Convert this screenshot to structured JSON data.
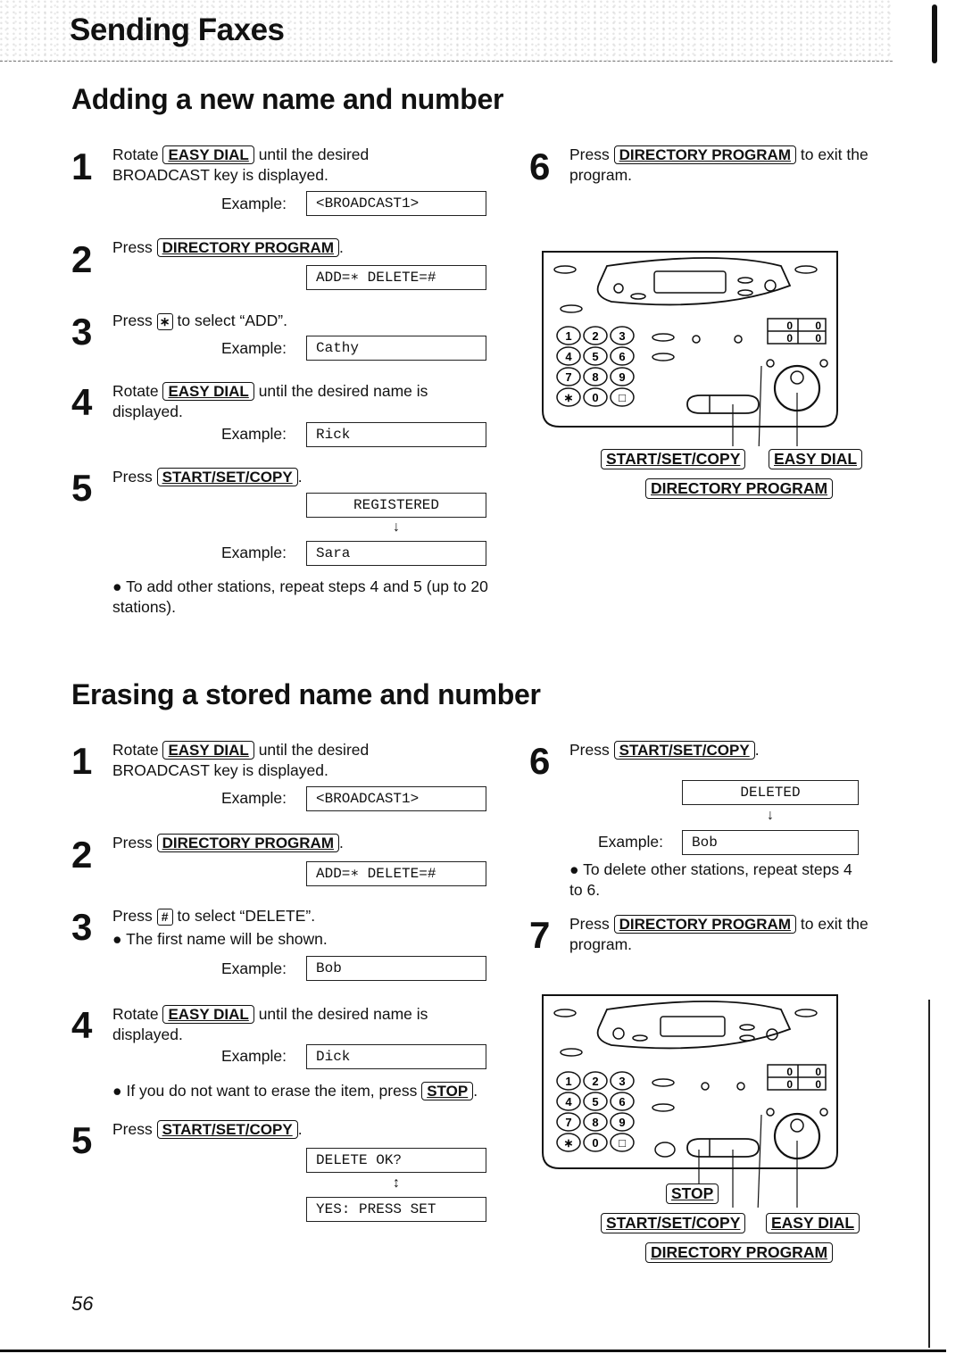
{
  "header": {
    "chapter_title": "Sending Faxes"
  },
  "sections": {
    "adding": {
      "title": "Adding a new name and number",
      "steps": [
        {
          "num": "1",
          "pre": "Rotate",
          "key": "EASY DIAL",
          "post": "until the desired BROADCAST key is displayed.",
          "example_label": "Example:",
          "display": "<BROADCAST1>"
        },
        {
          "num": "2",
          "pre": "Press",
          "key": "DIRECTORY PROGRAM",
          "post": ".",
          "display": "ADD=∗ DELETE=#"
        },
        {
          "num": "3",
          "pre": "Press",
          "key": "∗",
          "post": "to select “ADD”.",
          "example_label": "Example:",
          "display": "Cathy"
        },
        {
          "num": "4",
          "pre": "Rotate",
          "key": "EASY DIAL",
          "post": "until the desired name is displayed.",
          "example_label": "Example:",
          "display": "Rick"
        },
        {
          "num": "5",
          "pre": "Press",
          "key": "START/SET/COPY",
          "post": ".",
          "display_1": "REGISTERED",
          "arrow": "↓",
          "example_label": "Example:",
          "display_2": "Sara",
          "note": "To add other stations, repeat steps 4 and 5 (up to 20 stations)."
        },
        {
          "num": "6",
          "pre": "Press",
          "key": "DIRECTORY PROGRAM",
          "post": "to exit the program."
        }
      ],
      "diagram": {
        "callouts": [
          "START/SET/COPY",
          "EASY DIAL",
          "DIRECTORY PROGRAM"
        ],
        "keypad": [
          "1",
          "2",
          "3",
          "4",
          "5",
          "6",
          "7",
          "8",
          "9",
          "∗",
          "0",
          "□"
        ],
        "counter": [
          "0",
          "0",
          "0",
          "0"
        ]
      }
    },
    "erasing": {
      "title": "Erasing a stored name and number",
      "steps": [
        {
          "num": "1",
          "pre": "Rotate",
          "key": "EASY DIAL",
          "post": "until the desired BROADCAST key is displayed.",
          "example_label": "Example:",
          "display": "<BROADCAST1>"
        },
        {
          "num": "2",
          "pre": "Press",
          "key": "DIRECTORY PROGRAM",
          "post": ".",
          "display": "ADD=∗ DELETE=#"
        },
        {
          "num": "3",
          "pre": "Press",
          "key": "#",
          "post": "to select “DELETE”.",
          "note": "The first name will be shown.",
          "example_label": "Example:",
          "display": "Bob"
        },
        {
          "num": "4",
          "pre": "Rotate",
          "key": "EASY DIAL",
          "post": "until the desired name is displayed.",
          "example_label": "Example:",
          "display": "Dick",
          "note_pre": "If you do not want to erase the item, press",
          "note_key": "STOP",
          "note_post": "."
        },
        {
          "num": "5",
          "pre": "Press",
          "key": "START/SET/COPY",
          "post": ".",
          "display_1": "DELETE OK?",
          "arrow": "↕",
          "display_2": "YES: PRESS SET"
        },
        {
          "num": "6",
          "pre": "Press",
          "key": "START/SET/COPY",
          "post": ".",
          "display_1": "DELETED",
          "arrow": "↓",
          "example_label": "Example:",
          "display_2": "Bob",
          "note": "To delete other stations, repeat steps 4 to 6."
        },
        {
          "num": "7",
          "pre": "Press",
          "key": "DIRECTORY PROGRAM",
          "post": "to exit the program."
        }
      ],
      "diagram": {
        "callouts": [
          "STOP",
          "START/SET/COPY",
          "EASY DIAL",
          "DIRECTORY PROGRAM"
        ],
        "keypad": [
          "1",
          "2",
          "3",
          "4",
          "5",
          "6",
          "7",
          "8",
          "9",
          "∗",
          "0",
          "□"
        ],
        "counter": [
          "0",
          "0",
          "0",
          "0"
        ]
      }
    }
  },
  "footer": {
    "page_number": "56"
  }
}
